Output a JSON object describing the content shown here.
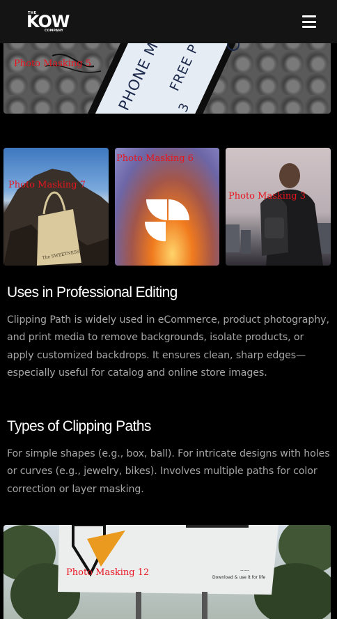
{
  "header": {
    "logo_the": "THE",
    "logo_main": "KOW",
    "logo_sub": "COMPANY",
    "menu_icon": "hamburger-menu-icon"
  },
  "gallery": {
    "top_image_label": "Photo Masking 5",
    "top_image_text": "PHONE MOCK",
    "top_image_text2": "FREE P",
    "row_labels": [
      "Photo Masking 7",
      "Photo Masking 6",
      "Photo Masking 3"
    ],
    "tote_text": "The SWEETNESS",
    "bottom_image_label": "Photo Masking 12",
    "billboard_text": "Download & use it for life"
  },
  "sections": [
    {
      "heading": "Uses in Professional Editing",
      "body": "Clipping Path is widely used in eCommerce, product photography, and print media to remove backgrounds, isolate products, or apply customized backdrops. It ensures clean, sharp edges—especially useful for catalog and online store images."
    },
    {
      "heading": "Types of Clipping Paths",
      "body": "For simple shapes (e.g., box, ball). For intricate designs with holes or curves (e.g., jewelry, bikes). Involves multiple paths for color correction or layer masking."
    }
  ],
  "colors": {
    "background": "#000000",
    "header": "#141414",
    "body_text": "#a6a6a6",
    "mask_label": "#e8141e"
  }
}
